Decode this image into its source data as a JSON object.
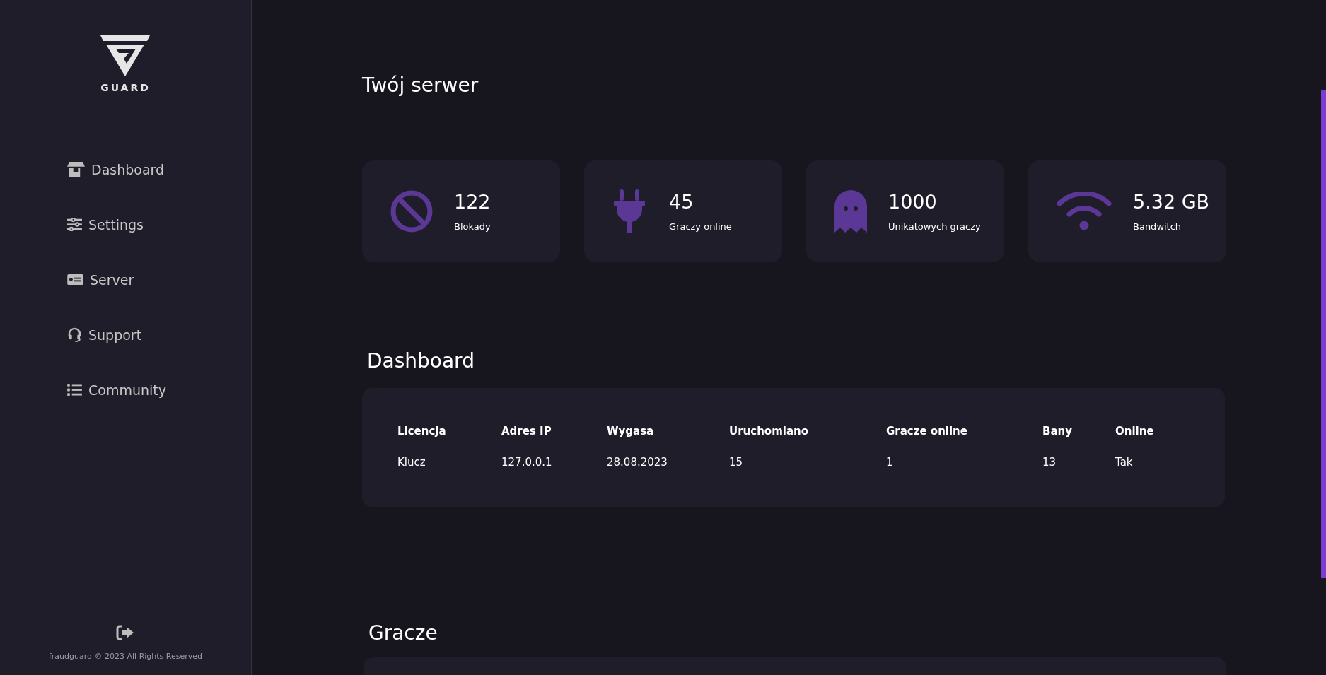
{
  "sidebar": {
    "logo_text": "GUARD",
    "items": [
      {
        "label": "Dashboard",
        "kind": "store"
      },
      {
        "label": "Settings",
        "kind": "sliders"
      },
      {
        "label": "Server",
        "kind": "money"
      },
      {
        "label": "Support",
        "kind": "headset"
      },
      {
        "label": "Community",
        "kind": "list"
      }
    ],
    "footer": "fraudguard © 2023 All Rights Reserved"
  },
  "page_title": "Twój serwer",
  "stats": [
    {
      "kind": "ban",
      "value": "122",
      "label": "Blokady"
    },
    {
      "kind": "plug",
      "value": "45",
      "label": "Graczy online"
    },
    {
      "kind": "ghost",
      "value": "1000",
      "label": "Unikatowych graczy"
    },
    {
      "kind": "wifi",
      "value": "5.32 GB",
      "label": "Bandwitch"
    }
  ],
  "dashboard": {
    "title": "Dashboard",
    "columns": [
      "Licencja",
      "Adres IP",
      "Wygasa",
      "Uruchomiano",
      "Gracze online",
      "Bany",
      "Online"
    ],
    "rows": [
      [
        "Klucz",
        "127.0.0.1",
        "28.08.2023",
        "15",
        "1",
        "13",
        "Tak"
      ]
    ]
  },
  "players": {
    "title": "Gracze"
  }
}
